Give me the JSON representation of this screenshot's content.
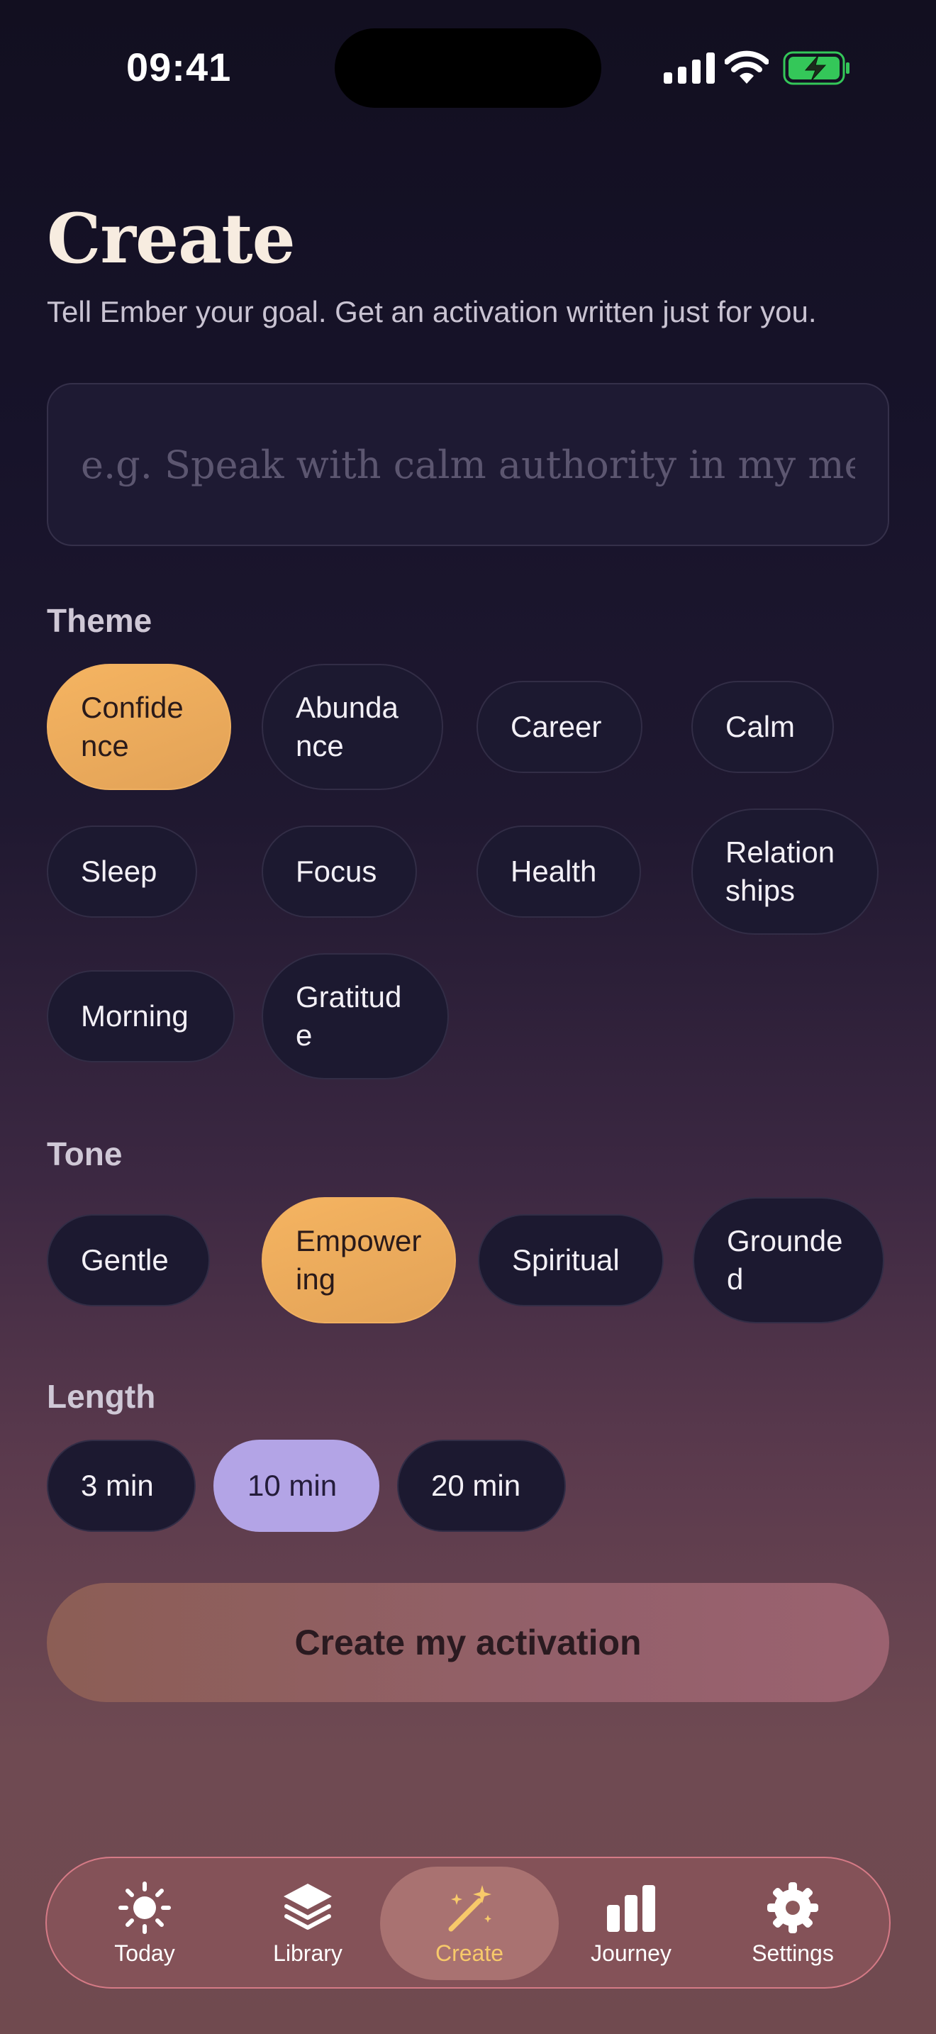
{
  "status_bar": {
    "time": "09:41"
  },
  "header": {
    "title": "Create",
    "subtitle": "Tell Ember your goal. Get an activation written just for you."
  },
  "goal_input": {
    "placeholder": "e.g. Speak with calm authority in my me...",
    "value": ""
  },
  "theme": {
    "label": "Theme",
    "selected": "Confidence",
    "options": [
      "Confidence",
      "Abundance",
      "Career",
      "Calm",
      "Sleep",
      "Focus",
      "Health",
      "Relationships",
      "Morning",
      "Gratitude"
    ]
  },
  "tone": {
    "label": "Tone",
    "selected": "Empowering",
    "options": [
      "Gentle",
      "Empowering",
      "Spiritual",
      "Grounded"
    ]
  },
  "length": {
    "label": "Length",
    "selected": "10 min",
    "options": [
      "3 min",
      "10 min",
      "20 min"
    ]
  },
  "cta": {
    "label": "Create my activation"
  },
  "tabbar": {
    "active": "Create",
    "tabs": [
      {
        "label": "Today",
        "icon": "sun-icon"
      },
      {
        "label": "Library",
        "icon": "layers-icon"
      },
      {
        "label": "Create",
        "icon": "magic-wand-icon"
      },
      {
        "label": "Journey",
        "icon": "bar-chart-icon"
      },
      {
        "label": "Settings",
        "icon": "gear-icon"
      }
    ]
  },
  "colors": {
    "accent_orange": "#f0ad5e",
    "accent_lavender": "#b3a4e6",
    "title_cream": "#f7ece0",
    "battery_green": "#34c759",
    "tab_active_label": "#f7c96a"
  }
}
